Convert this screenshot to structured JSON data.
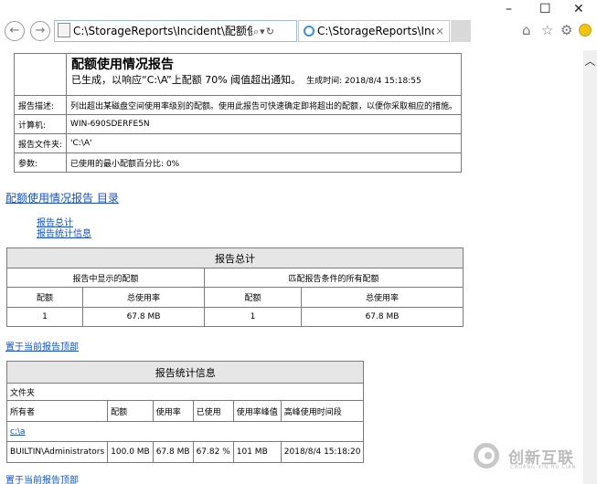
{
  "browser": {
    "address": "C:\\StorageReports\\Incident\\配额使用情况",
    "search_icon": "⌕",
    "dropdown_icon": "▾",
    "refresh_icon": "↻",
    "tab_title": "C:\\StorageReports\\Incid...",
    "tab_close": "×",
    "minimize": "–",
    "maximize": "☐",
    "close": "✕",
    "home_icon": "⌂",
    "star_icon": "☆",
    "gear_icon": "⚙",
    "back_icon": "←",
    "forward_icon": "→"
  },
  "report_header": {
    "title": "配额使用情况报告",
    "subtitle": "已生成，以响应“C:\\A”上配额 70% 阈值超出通知。",
    "generated": "生成时间: 2018/8/4 15:18:55",
    "rows": [
      {
        "label": "报告描述:",
        "value": "列出超出某磁盘空间使用率级别的配额。使用此报告可快速确定即将超出的配额，以便你采取相应的措施。"
      },
      {
        "label": "计算机:",
        "value": "WIN-690SDERFE5N"
      },
      {
        "label": "报告文件夹:",
        "value": "'C:\\A'"
      },
      {
        "label": "参数:",
        "value": "已使用的最小配额百分比: 0%"
      }
    ]
  },
  "toc": {
    "title": "配额使用情况报告 目录",
    "links": [
      "报告总计",
      "报告统计信息"
    ]
  },
  "summary": {
    "title": "报告总计",
    "group_left": "报告中显示的配额",
    "group_right": "匹配报告条件的所有配额",
    "columns": [
      "配额",
      "总使用率",
      "配额",
      "总使用率"
    ],
    "row": [
      "1",
      "67.8 MB",
      "1",
      "67.8 MB"
    ]
  },
  "back_to_top": "置于当前报告顶部",
  "stats": {
    "title": "报告统计信息",
    "group_label": "文件夹",
    "columns": [
      "所有者",
      "配额",
      "使用率",
      "已使用",
      "使用率峰值",
      "高峰使用时间段"
    ],
    "folder": "c:\\a",
    "row": [
      "BUILTIN\\Administrators",
      "100.0 MB",
      "67.8 MB",
      "67.82 %",
      "101 MB",
      "2018/8/4 15:18:20"
    ]
  },
  "watermark": {
    "text": "创新互联",
    "sub": "CHUANG XIN HU LIAN"
  },
  "colors": {
    "link": "#1a50c8",
    "header_bg": "#e6e6e6",
    "border": "#7a7a7a"
  }
}
